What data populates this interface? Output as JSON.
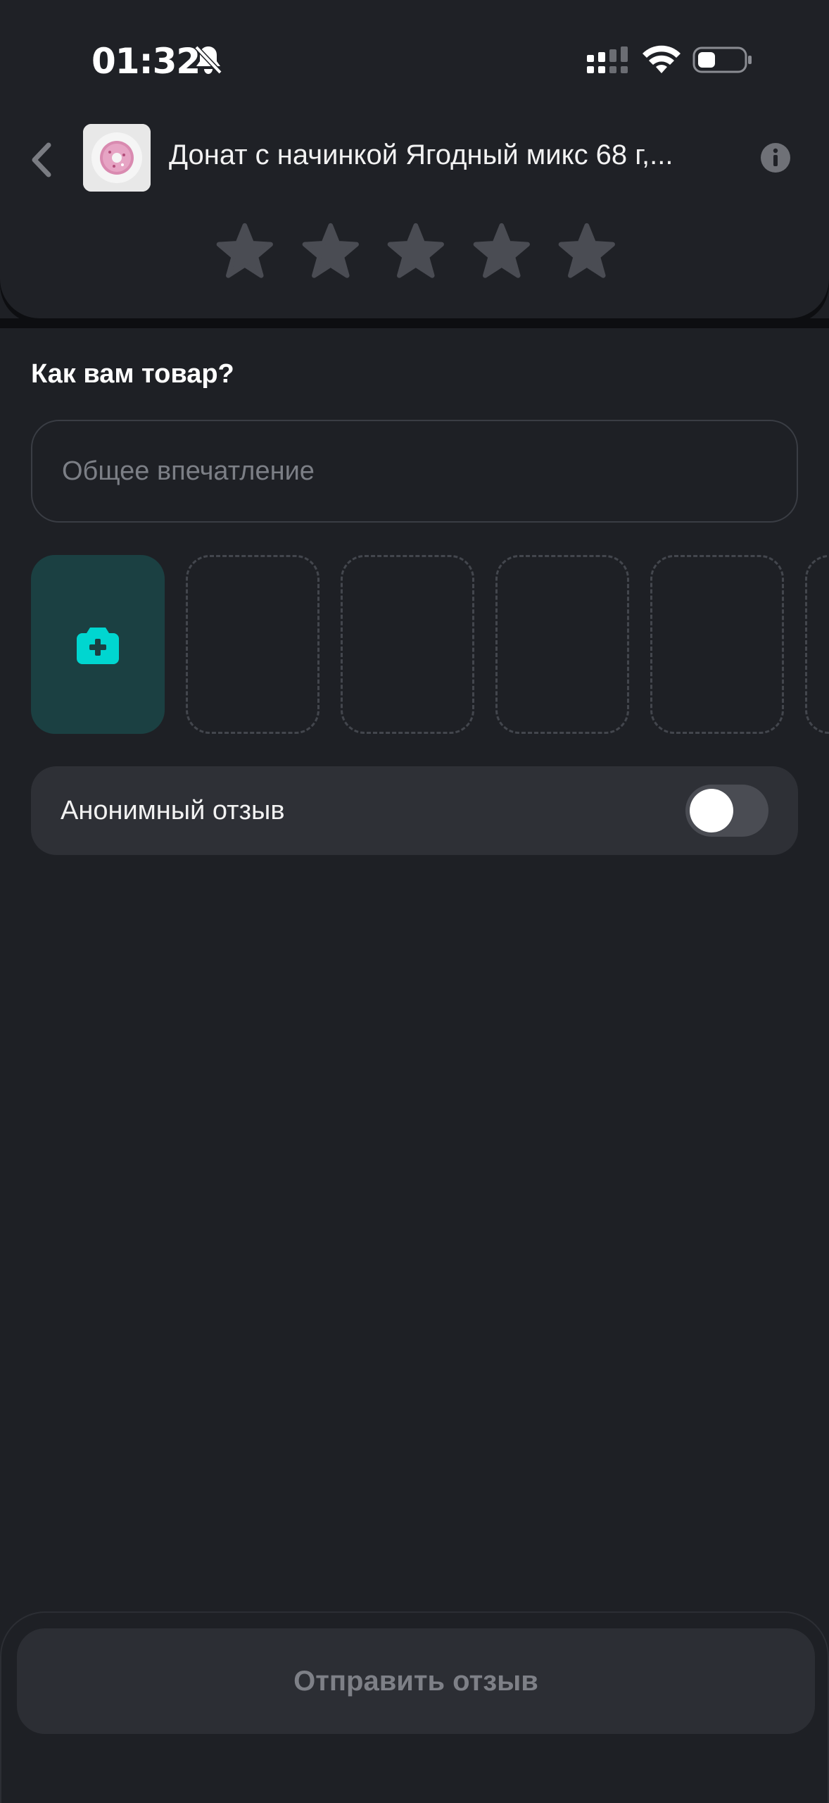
{
  "status_bar": {
    "time": "01:32",
    "icons": [
      "bell-slash-icon",
      "cellular-signal-icon",
      "wifi-icon",
      "battery-icon"
    ]
  },
  "header": {
    "back_icon": "chevron-left-icon",
    "product_title": "Донат с начинкой Ягодный микс 68 г,...",
    "info_icon": "info-icon",
    "rating": {
      "max": 5,
      "selected": 0
    }
  },
  "review": {
    "question": "Как вам товар?",
    "impression_placeholder": "Общее впечатление",
    "add_photo_icon": "camera-plus-icon",
    "empty_photo_slots": 4,
    "anonymous_label": "Анонимный отзыв",
    "anonymous_enabled": false
  },
  "footer": {
    "submit_label": "Отправить отзыв"
  },
  "colors": {
    "background": "#1e2025",
    "card": "#2e3036",
    "accent": "#00d6d0",
    "accent_bg": "#1b4042",
    "star_inactive": "#4a4c53"
  }
}
